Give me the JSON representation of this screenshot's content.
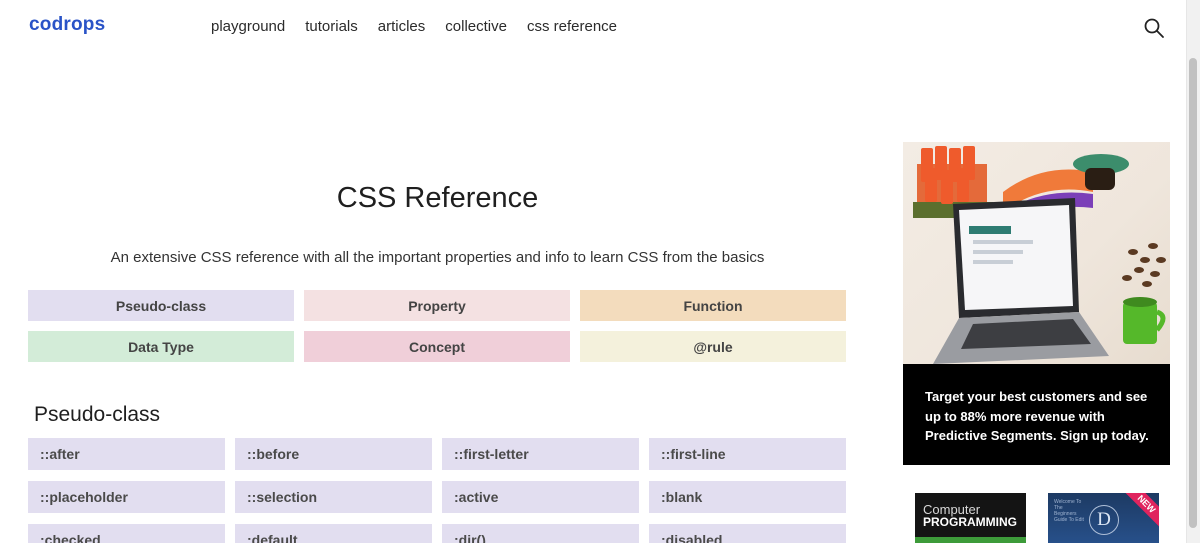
{
  "header": {
    "logo": "codrops",
    "nav": [
      "playground",
      "tutorials",
      "articles",
      "collective",
      "css reference"
    ],
    "search_icon": "search-icon"
  },
  "main": {
    "title": "CSS Reference",
    "subtitle": "An extensive CSS reference with all the important properties and info to learn CSS from the basics",
    "categories": [
      {
        "label": "Pseudo-class",
        "color": "#e2def0"
      },
      {
        "label": "Property",
        "color": "#f4e1e2"
      },
      {
        "label": "Function",
        "color": "#f3dcbd"
      },
      {
        "label": "Data Type",
        "color": "#d3ecd8"
      },
      {
        "label": "Concept",
        "color": "#f0cfd9"
      },
      {
        "label": "@rule",
        "color": "#f4f1dc"
      }
    ],
    "section_title": "Pseudo-class",
    "items": [
      "::after",
      "::before",
      "::first-letter",
      "::first-line",
      "::placeholder",
      "::selection",
      ":active",
      ":blank",
      ":checked",
      ":default",
      ":dir()",
      ":disabled"
    ]
  },
  "ad": {
    "text": "Target your best customers and see up to 88% more revenue with Predictive Segments. Sign up today."
  },
  "books": [
    {
      "line1": "Computer",
      "line2": "PROGRAMMING"
    },
    {
      "badge": "NEW",
      "letter": "D",
      "small_text": "Welcome To The Beginners Guide To Edit"
    }
  ],
  "colors": {
    "brand": "#2a53c7",
    "item_bg": "#e2def0",
    "ad_bg": "#000000"
  }
}
